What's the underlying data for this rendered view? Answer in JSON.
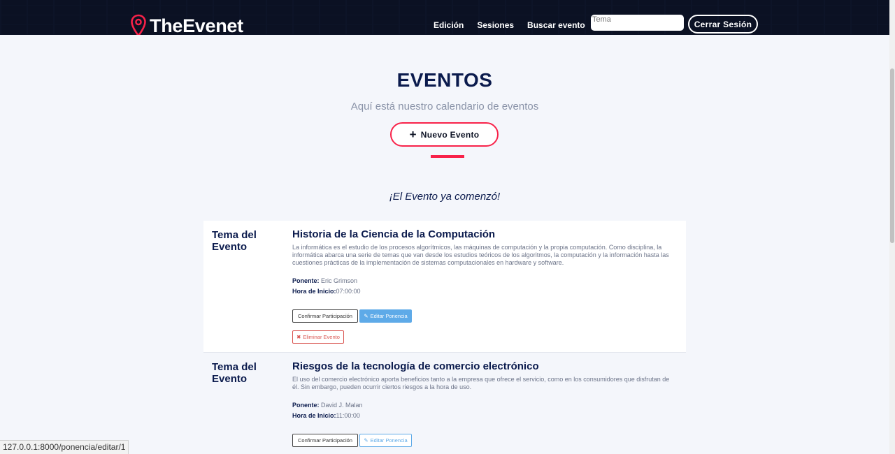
{
  "header": {
    "logo_text": "TheEvenet",
    "nav": [
      {
        "label": "Edición",
        "active": true
      },
      {
        "label": "Sesiones",
        "active": false
      },
      {
        "label": "Buscar evento",
        "active": false
      }
    ],
    "search_placeholder": "Tema",
    "logout_label": "Cerrar Sesión"
  },
  "hero": {
    "title": "EVENTOS",
    "subtitle": "Aquí está nuestro calendario de eventos",
    "new_event_label": "Nuevo Evento",
    "new_event_icon": "plus-icon",
    "started_label": "¡El Evento ya comenzó!"
  },
  "events": [
    {
      "theme_label": "Tema del Evento",
      "title": "Historia de la Ciencia de la Computación",
      "description": "La informática es el estudio de los procesos algorítmicos, las máquinas de computación y la propia computación. Como disciplina, la informática abarca una serie de temas que van desde los estudios teóricos de los algoritmos, la computación y la información hasta las cuestiones prácticas de la implementación de sistemas computacionales en hardware y software.",
      "speaker_label": "Ponente:",
      "speaker": "Eric Grimson",
      "start_label": "Hora de Inicio:",
      "start_time": "07:00:00",
      "confirm_label": "Confirmar Participación",
      "edit_label": "Editar Ponencia",
      "delete_label": "Eliminar Evento"
    },
    {
      "theme_label": "Tema del Evento",
      "title": "Riesgos de la tecnología de comercio electrónico",
      "description": "El uso del comercio electrónico aporta beneficios tanto a la empresa que ofrece el servicio, como en los consumidores que disfrutan de él. Sin embargo, pueden ocurrir ciertos riesgos a la hora de uso.",
      "speaker_label": "Ponente:",
      "speaker": "David J. Malan",
      "start_label": "Hora de Inicio:",
      "start_time": "11:00:00",
      "confirm_label": "Confirmar Participación",
      "edit_label": "Editar Ponencia"
    }
  ],
  "status_url": "127.0.0.1:8000/ponencia/editar/1",
  "colors": {
    "accent": "#f82249",
    "navy": "#0b1b4d",
    "header_bg": "#0b1123",
    "edit_blue": "#5eaae8",
    "danger": "#d9534f"
  }
}
